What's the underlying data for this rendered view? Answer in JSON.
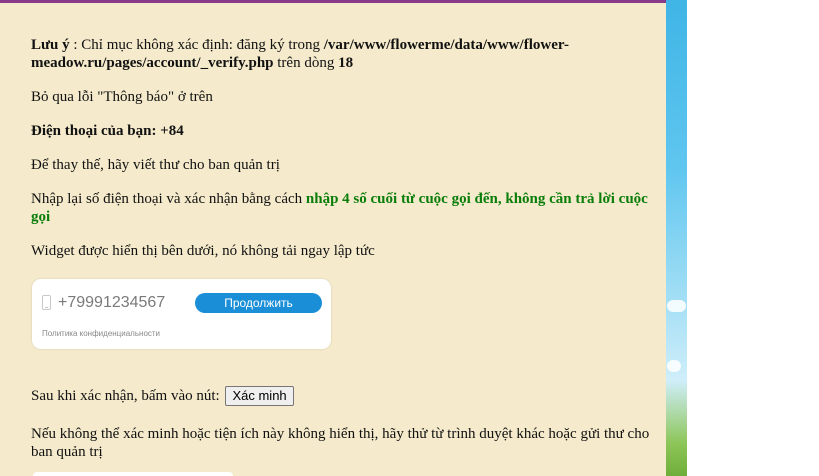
{
  "notice": {
    "label": "Lưu ý",
    "text_before": " : Chỉ mục không xác định: đăng ký trong ",
    "path": "/var/www/flowerme/data/www/flower-meadow.ru/pages/account/_verify.php",
    "text_line": " trên dòng ",
    "line_number": "18"
  },
  "skip_notice": "Bỏ qua lỗi \"Thông báo\" ở trên",
  "phone": {
    "label": "Điện thoại của bạn: +84"
  },
  "alternative": "Để thay thế, hãy viết thư cho ban quản trị",
  "instruction": {
    "text": "Nhập lại số điện thoại và xác nhận bằng cách ",
    "highlight": "nhập 4 số cuối từ cuộc gọi đến, không cần trả lời cuộc gọi"
  },
  "widget_hint": "Widget được hiển thị bên dưới, nó không tải ngay lập tức",
  "widget": {
    "phone_number": "+79991234567",
    "continue_label": "Продолжить",
    "privacy_label": "Политика конфиденциальности"
  },
  "verify": {
    "prompt": "Sau khi xác nhận, bấm vào nút:",
    "button_label": "Xác minh"
  },
  "fallback_note": "Nếu không thể xác minh hoặc tiện ích này không hiển thị, hãy thử từ trình duyệt khác hoặc gửi thư cho ban quản trị",
  "colors": {
    "panel_background": "#f5ebcc",
    "highlight_green": "#0a7d0a",
    "widget_button": "#1a8fd8",
    "top_border": "#8a3a8a"
  },
  "icons": {
    "phone": "smartphone-icon"
  }
}
